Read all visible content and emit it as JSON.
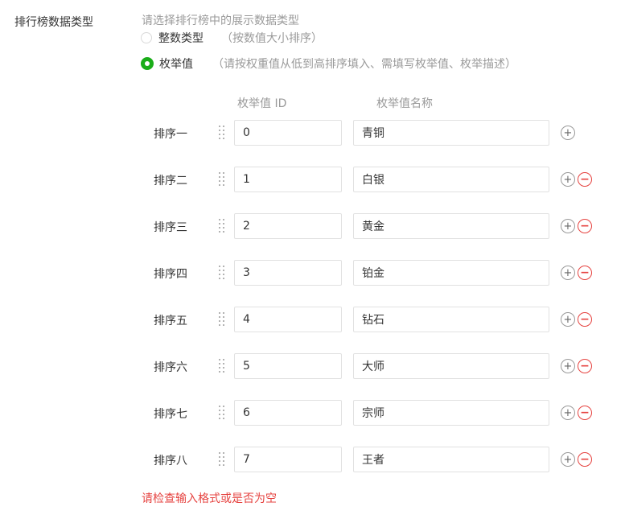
{
  "section_label": "排行榜数据类型",
  "hint": "请选择排行榜中的展示数据类型",
  "radio_options": [
    {
      "label": "整数类型",
      "desc": "（按数值大小排序）",
      "checked": false
    },
    {
      "label": "枚举值",
      "desc": "（请按权重值从低到高排序填入、需填写枚举值、枚举描述）",
      "checked": true
    }
  ],
  "columns": {
    "id_header": "枚举值 ID",
    "name_header": "枚举值名称"
  },
  "rows": [
    {
      "label": "排序一",
      "id": "0",
      "name": "青铜",
      "removable": false
    },
    {
      "label": "排序二",
      "id": "1",
      "name": "白银",
      "removable": true
    },
    {
      "label": "排序三",
      "id": "2",
      "name": "黄金",
      "removable": true
    },
    {
      "label": "排序四",
      "id": "3",
      "name": "铂金",
      "removable": true
    },
    {
      "label": "排序五",
      "id": "4",
      "name": "钻石",
      "removable": true
    },
    {
      "label": "排序六",
      "id": "5",
      "name": "大师",
      "removable": true
    },
    {
      "label": "排序七",
      "id": "6",
      "name": "宗师",
      "removable": true
    },
    {
      "label": "排序八",
      "id": "7",
      "name": "王者",
      "removable": true
    }
  ],
  "icons": {
    "drag": "drag-handle-icon",
    "add": "plus-circle-icon",
    "remove": "minus-circle-icon"
  },
  "error_message": "请检查输入格式或是否为空",
  "colors": {
    "accent": "#1aad19",
    "error": "#e64340",
    "muted": "#9a9a9a"
  }
}
